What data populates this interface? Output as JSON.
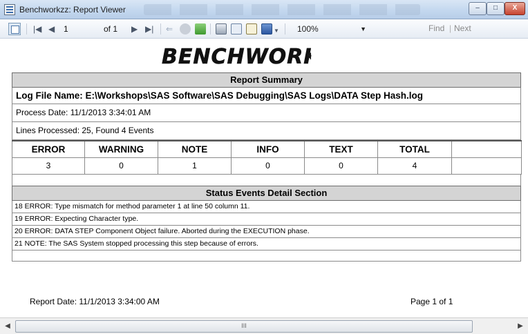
{
  "window": {
    "title": "Benchworkzz: Report Viewer",
    "controls": {
      "minimize": "–",
      "maximize": "□",
      "close": "X"
    }
  },
  "toolbar": {
    "page_current": "1",
    "page_of": "of 1",
    "zoom": "100%",
    "find": "Find",
    "find_separator": "|",
    "next": "Next",
    "nav": {
      "first": "|◀",
      "prev": "◀",
      "next": "▶",
      "last": "▶|"
    }
  },
  "report": {
    "logo_text": "BENCHWORKZZ",
    "logo_mark": "®",
    "summary_title": "Report Summary",
    "log_file": "Log File Name: E:\\Workshops\\SAS Software\\SAS Debugging\\SAS Logs\\DATA Step Hash.log",
    "process_date": "Process Date: 11/1/2013 3:34:01 AM",
    "lines_processed": "Lines Processed: 25, Found 4 Events",
    "counts": {
      "headers": [
        "ERROR",
        "WARNING",
        "NOTE",
        "INFO",
        "TEXT",
        "TOTAL",
        ""
      ],
      "values": [
        "3",
        "0",
        "1",
        "0",
        "0",
        "4",
        ""
      ]
    },
    "status_title": "Status Events Detail Section",
    "events": [
      "18  ERROR: Type mismatch for method parameter 1 at line 50 column 11.",
      "19  ERROR: Expecting Character type.",
      "20  ERROR: DATA STEP Component Object failure.  Aborted during the EXECUTION phase.",
      "21  NOTE: The SAS System stopped processing this step because of errors."
    ],
    "report_date": "Report Date: 11/1/2013 3:34:00 AM",
    "page_label": "Page 1 of 1"
  },
  "scrollbar": {
    "left_arrow": "◀",
    "grip": "III",
    "right_arrow": "▶"
  },
  "colors": {
    "header_band": "#d4d4d4",
    "titlebar": "#c4d8ef",
    "close_button": "#c7432f",
    "logo": "#111111"
  }
}
